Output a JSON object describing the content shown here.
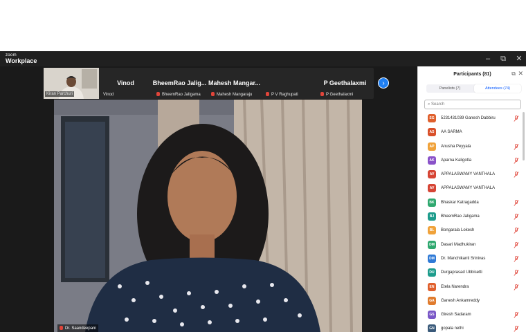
{
  "app": {
    "brand_small": "zoom",
    "brand": "Workplace"
  },
  "window_controls": {
    "minimize": "–",
    "maximize": "⧉",
    "close": "✕"
  },
  "strip": {
    "first_tile_name": "Kiran Parchuri",
    "tiles": [
      {
        "big": "Vinod",
        "small": "Vinod",
        "muted": false
      },
      {
        "big": "BheemRao  Jalig...",
        "small": "BheemRao Jaligama",
        "muted": true
      },
      {
        "big": "Mahesh  Mangar...",
        "small": "Mahesh Mangaraju",
        "muted": true
      },
      {
        "big": "",
        "small": "P V Raghupati",
        "muted": true
      },
      {
        "big": "P Geethalaxmi",
        "small": "P Geethalaxmi",
        "muted": true
      }
    ],
    "next_icon": "chevron-right-icon"
  },
  "main_video": {
    "speaker": "Dr. Saandeepani"
  },
  "panel": {
    "title": "Participants (81)",
    "tabs": [
      {
        "label": "Panelists (7)"
      },
      {
        "label": "Attendees (74)"
      }
    ],
    "active_tab": 1,
    "search_placeholder": "Search",
    "participants": [
      {
        "initials": "SG",
        "name": "5231431039 Ganesh Dabbiru",
        "color": "#e0602d",
        "muted": true
      },
      {
        "initials": "AS",
        "name": "AA SARMA",
        "color": "#d9502a",
        "muted": false
      },
      {
        "initials": "AP",
        "name": "Anusha Peyyala",
        "color": "#f0a23a",
        "muted": true
      },
      {
        "initials": "AK",
        "name": "Aparna Kaligotla",
        "color": "#8a52c9",
        "muted": true
      },
      {
        "initials": "AV",
        "name": "APPALASWAMY VANTHALA",
        "color": "#d64535",
        "muted": true
      },
      {
        "initials": "AV",
        "name": "APPALASWAMY VANTHALA",
        "color": "#d64535",
        "muted": false
      },
      {
        "initials": "BK",
        "name": "Bhaskar Katragadda",
        "color": "#2fa86f",
        "muted": true
      },
      {
        "initials": "BJ",
        "name": "BheemRao Jaligama",
        "color": "#1d9c8c",
        "muted": true
      },
      {
        "initials": "BL",
        "name": "Bongarala Lokesh",
        "color": "#f0a23a",
        "muted": true
      },
      {
        "initials": "DM",
        "name": "Dasari Madhukiran",
        "color": "#2fa86f",
        "muted": true
      },
      {
        "initials": "DM",
        "name": "Dr. Manchikanti Srinivas",
        "color": "#2f7ad6",
        "muted": true
      },
      {
        "initials": "DU",
        "name": "Durgaprasad Ubbisetti",
        "color": "#1d9c8c",
        "muted": true
      },
      {
        "initials": "EN",
        "name": "Etela Narendra",
        "color": "#e0602d",
        "muted": true
      },
      {
        "initials": "GA",
        "name": "Ganesh Ankamreddy",
        "color": "#e07b2d",
        "muted": false
      },
      {
        "initials": "GS",
        "name": "Giresh Sadaram",
        "color": "#7a58c7",
        "muted": true
      },
      {
        "initials": "GN",
        "name": "gopala nethi",
        "color": "#3a5a7a",
        "muted": true
      }
    ]
  }
}
